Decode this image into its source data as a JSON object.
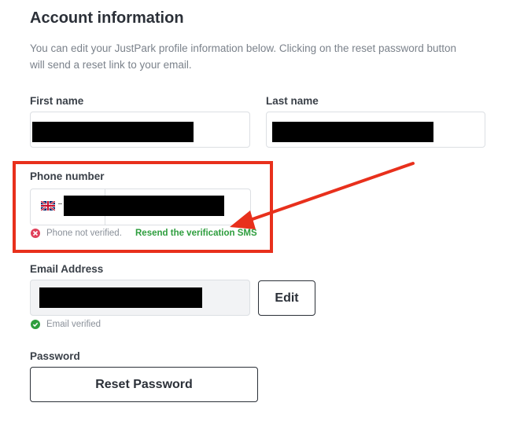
{
  "header": {
    "title": "Account information",
    "description": "You can edit your JustPark profile information below. Clicking on the reset password button will send a reset link to your email."
  },
  "first_name": {
    "label": "First name"
  },
  "last_name": {
    "label": "Last name"
  },
  "phone": {
    "label": "Phone number",
    "country_icon": "uk-flag-icon",
    "status_text": "Phone not verified.",
    "resend_link": "Resend the verification SMS"
  },
  "email": {
    "label": "Email Address",
    "edit_button": "Edit",
    "status_text": "Email verified"
  },
  "password": {
    "label": "Password",
    "reset_button": "Reset Password"
  },
  "colors": {
    "highlight": "#e8301c",
    "verified_green": "#2e9e3e",
    "error_red": "#e0405a"
  }
}
